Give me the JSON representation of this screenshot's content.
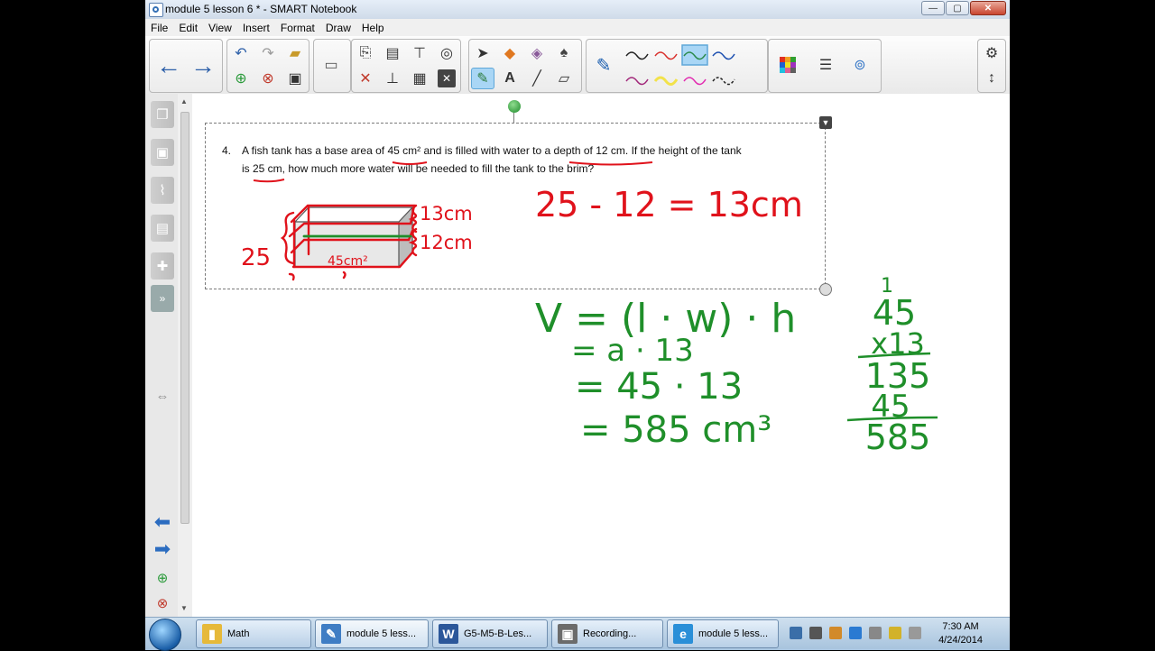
{
  "window": {
    "title": "module 5 lesson 6 * - SMART Notebook"
  },
  "menu": [
    "File",
    "Edit",
    "View",
    "Insert",
    "Format",
    "Draw",
    "Help"
  ],
  "question": {
    "number": "4.",
    "line1": "A fish tank has a base area of 45 cm² and is filled with water to a depth of 12 cm.  If the height of the tank",
    "line2": "is 25 cm, how much more water will be needed to fill the tank to the brim?"
  },
  "handwriting": {
    "tank_labels": [
      "13cm",
      "12cm",
      "25",
      "45cm²"
    ],
    "subtraction": "25 - 12 = 13cm",
    "volume_steps": [
      "V = (l · w) · h",
      "= a · 13",
      "= 45 · 13",
      "= 585 cm³"
    ],
    "multiplication": [
      "1",
      "45",
      "x13",
      "135",
      "45",
      "585"
    ]
  },
  "taskbar": {
    "items": [
      "Math",
      "module 5 less...",
      "G5-M5-B-Les...",
      "Recording...",
      "module 5 less..."
    ],
    "time": "7:30 AM",
    "date": "4/24/2014"
  },
  "colors": {
    "ink_red": "#e0121b",
    "ink_green": "#1f8f2a"
  }
}
